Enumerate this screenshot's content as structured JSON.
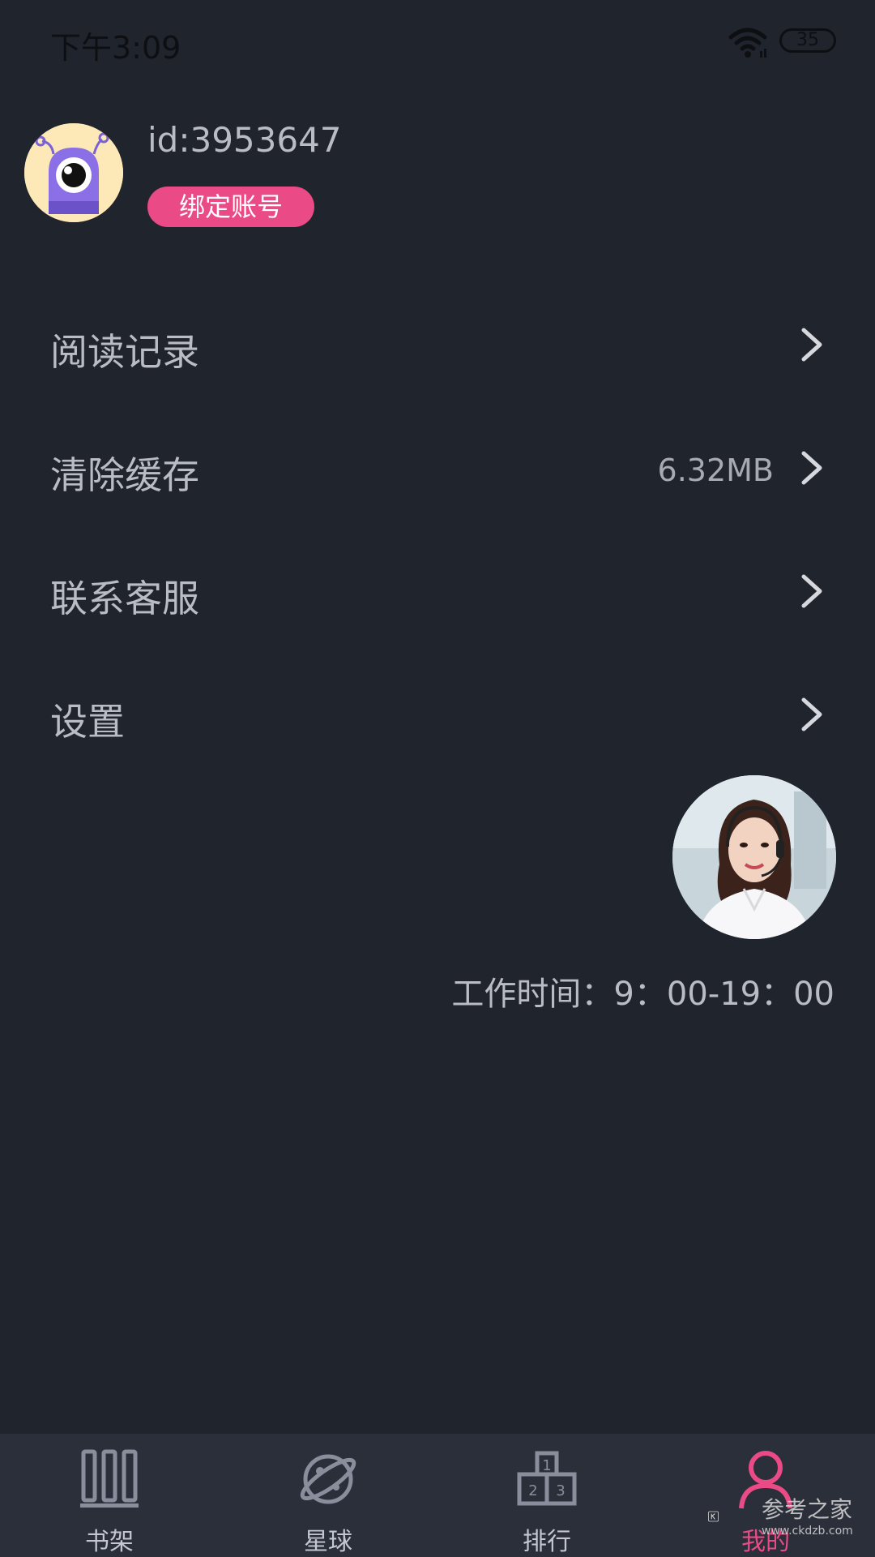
{
  "status_bar": {
    "time": "下午3:09",
    "battery": "35"
  },
  "profile": {
    "user_id": "id:3953647",
    "bind_button_label": "绑定账号"
  },
  "menu": {
    "items": [
      {
        "label": "阅读记录",
        "value": ""
      },
      {
        "label": "清除缓存",
        "value": "6.32MB"
      },
      {
        "label": "联系客服",
        "value": ""
      },
      {
        "label": "设置",
        "value": ""
      }
    ]
  },
  "service": {
    "work_hours": "工作时间：9：00-19：00"
  },
  "bottom_nav": {
    "items": [
      {
        "label": "书架",
        "icon": "bookshelf-icon"
      },
      {
        "label": "星球",
        "icon": "planet-icon"
      },
      {
        "label": "排行",
        "icon": "ranking-icon"
      },
      {
        "label": "我的",
        "icon": "profile-icon"
      }
    ],
    "active_color": "#ea4a86",
    "inactive_color": "#c4c7cf"
  },
  "watermark": {
    "text": "参考之家",
    "url": "www.ckdzb.com"
  },
  "colors": {
    "background": "#20242d",
    "nav_background": "#2a2f3a",
    "accent": "#ea4a86",
    "text": "#b9bcc4"
  }
}
